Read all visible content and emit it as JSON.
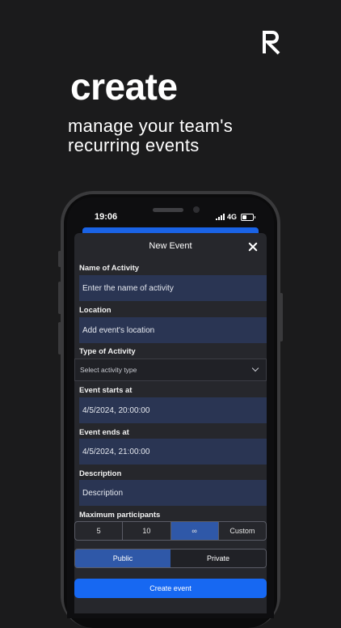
{
  "promo": {
    "headline": "create",
    "subline": "manage your team's recurring events"
  },
  "status": {
    "time": "19:06",
    "network": "4G"
  },
  "modal": {
    "title": "New Event",
    "fields": {
      "name_label": "Name of Activity",
      "name_placeholder": "Enter the name of activity",
      "location_label": "Location",
      "location_placeholder": "Add event's location",
      "type_label": "Type of Activity",
      "type_placeholder": "Select activity type",
      "start_label": "Event starts at",
      "start_value": "4/5/2024, 20:00:00",
      "end_label": "Event ends at",
      "end_value": "4/5/2024, 21:00:00",
      "description_label": "Description",
      "description_placeholder": "Description",
      "max_label": "Maximum participants"
    },
    "participants": {
      "options": [
        "5",
        "10",
        "∞",
        "Custom"
      ],
      "selected": "∞"
    },
    "visibility": {
      "options": [
        "Public",
        "Private"
      ],
      "selected": "Public"
    },
    "submit_label": "Create event"
  },
  "colors": {
    "background": "#1b1b1c",
    "field": "#2a3553",
    "accent": "#1768f2",
    "selected_segment": "#2f58a8"
  },
  "icons": [
    "r-logo-icon",
    "signal-icon",
    "battery-icon",
    "close-icon",
    "chevron-down-icon"
  ]
}
